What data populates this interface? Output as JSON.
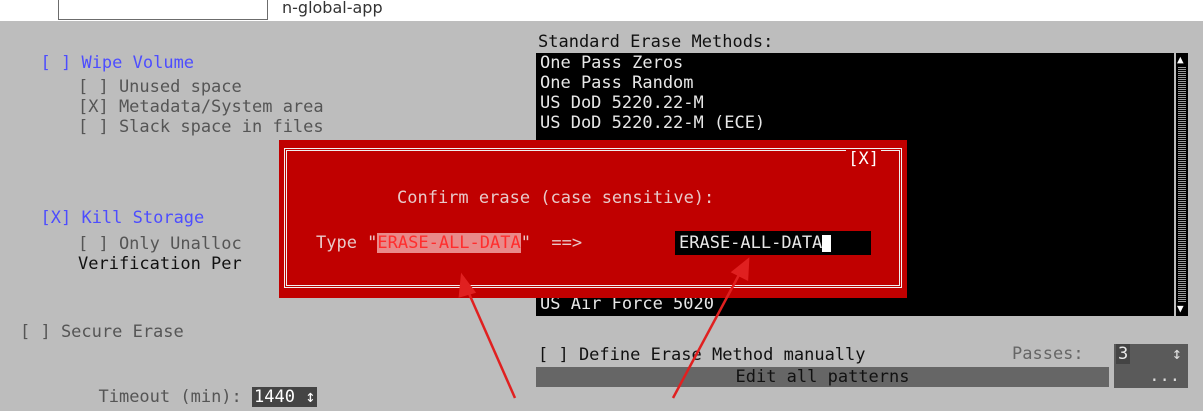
{
  "top": {
    "trailing_text": "n-global-app"
  },
  "wipe_volume": {
    "checkbox": "[ ]",
    "label": "Wipe Volume",
    "options": [
      {
        "text": "[ ] Unused space"
      },
      {
        "text": "[X] Metadata/System area"
      },
      {
        "text": "[ ] Slack space in files"
      }
    ]
  },
  "kill_storage": {
    "checkbox": "[X]",
    "label": "Kill Storage",
    "only_unalloc": "[ ] Only Unalloc",
    "verification": "Verification Per"
  },
  "secure_erase": {
    "label": "[ ] Secure Erase",
    "timeout_label": "Timeout (min):",
    "timeout_value": "1440",
    "timeout_spinner": "↕"
  },
  "methods": {
    "heading": "Standard Erase Methods:",
    "items_top": [
      "One Pass Zeros",
      "One Pass Random",
      "US DoD 5220.22-M",
      "US DoD 5220.22-M (ECE)"
    ],
    "item_bottom": "US Air Force 5020",
    "scroll_up": "▲",
    "scroll_down": "▼"
  },
  "manual": {
    "label": "[ ] Define Erase Method manually",
    "passes_label": "Passes:",
    "passes_value": "3",
    "passes_spinner": "↕",
    "edit_label": "Edit all patterns",
    "dots": "..."
  },
  "dialog": {
    "close": "[X]",
    "prompt": "Confirm erase (case sensitive):",
    "type_prefix": "Type \"",
    "phrase": "ERASE-ALL-DATA",
    "type_suffix": "\"  ==>",
    "input_value": "ERASE-ALL-DATA"
  },
  "colors": {
    "panel": "#bdbdbd",
    "dialog": "#c00000",
    "accent": "#4d4dff",
    "arrow": "#e02020"
  }
}
